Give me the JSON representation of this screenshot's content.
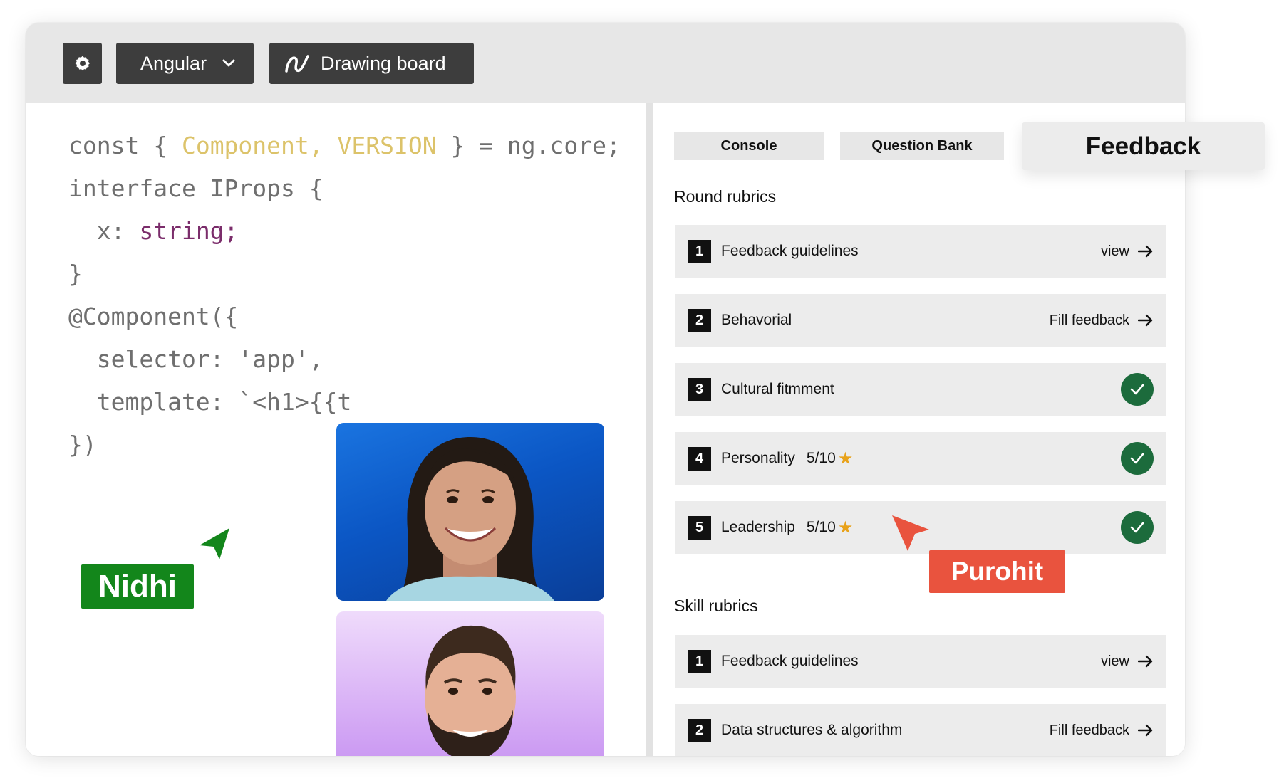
{
  "toolbar": {
    "settings_icon": "gear-icon",
    "framework_label": "Angular",
    "framework_icon": "chevron-down-icon",
    "drawing_board_label": "Drawing board",
    "drawing_board_icon": "squiggle-icon"
  },
  "code": {
    "l1_a": "const { ",
    "l1_b": "Component, VERSION",
    "l1_c": " } = ng.core;",
    "l2": "interface IProps {",
    "l3_a": "  x: ",
    "l3_b": "string;",
    "l4": "}",
    "l5": "@Component({",
    "l6": "  selector: 'app',",
    "l7": "  template: `<h1>{{t",
    "l8": "})"
  },
  "participants": {
    "local_name": "Nidhi",
    "remote_name": "Purohit",
    "local_color": "#13861b",
    "remote_color": "#e9533e"
  },
  "tabs": {
    "console": "Console",
    "question_bank": "Question Bank",
    "feedback": "Feedback"
  },
  "round_rubrics": {
    "title": "Round rubrics",
    "items": [
      {
        "num": "1",
        "label": "Feedback guidelines",
        "action": "view"
      },
      {
        "num": "2",
        "label": "Behavorial",
        "action": "Fill feedback"
      },
      {
        "num": "3",
        "label": "Cultural fitmment",
        "status": "complete"
      },
      {
        "num": "4",
        "label": "Personality",
        "score": "5/10",
        "status": "complete"
      },
      {
        "num": "5",
        "label": "Leadership",
        "score": "5/10",
        "status": "complete"
      }
    ]
  },
  "skill_rubrics": {
    "title": "Skill rubrics",
    "items": [
      {
        "num": "1",
        "label": "Feedback guidelines",
        "action": "view"
      },
      {
        "num": "2",
        "label": "Data structures & algorithm",
        "action": "Fill feedback"
      }
    ]
  }
}
